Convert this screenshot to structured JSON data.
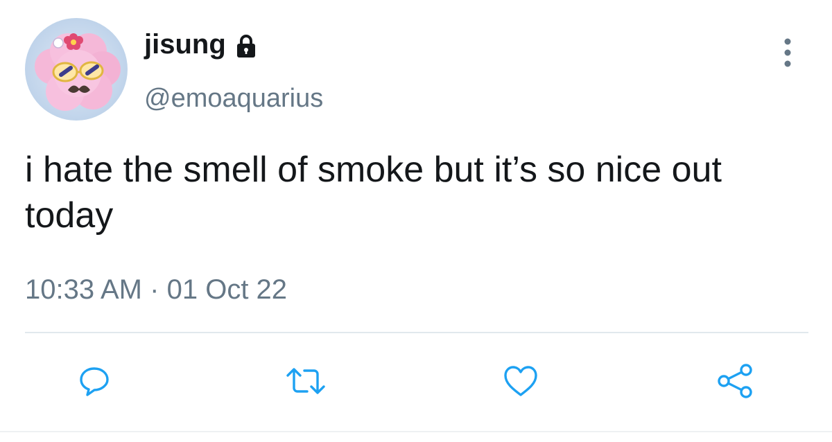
{
  "user": {
    "display_name": "jisung",
    "handle": "@emoaquarius",
    "avatar": "avatar-image",
    "protected_icon": "lock-icon"
  },
  "tweet": {
    "text": "i hate the smell of smoke but it’s so nice out today",
    "time": "10:33 AM",
    "separator": "·",
    "date": "01 Oct 22"
  },
  "actions": [
    {
      "icon": "reply-icon"
    },
    {
      "icon": "retweet-icon"
    },
    {
      "icon": "like-icon"
    },
    {
      "icon": "share-icon"
    }
  ],
  "colors": {
    "text": "#14171a",
    "secondary": "#657786",
    "icon": "#1da1f2",
    "divider": "#e1e8ed"
  }
}
